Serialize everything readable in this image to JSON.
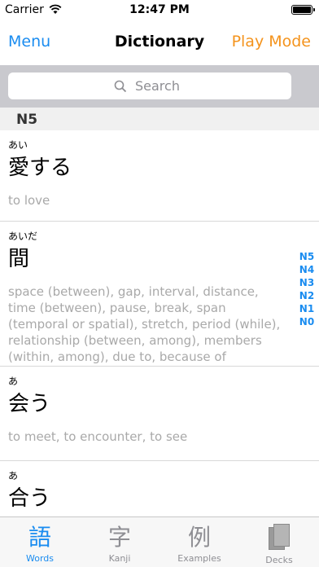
{
  "status": {
    "carrier": "Carrier",
    "time": "12:47 PM"
  },
  "nav": {
    "left": "Menu",
    "title": "Dictionary",
    "right": "Play Mode"
  },
  "search": {
    "placeholder": "Search"
  },
  "section": {
    "title": "N5"
  },
  "entries": [
    {
      "reading": "あい",
      "word": "愛する",
      "meaning": "to love"
    },
    {
      "reading": "あいだ",
      "word": "間",
      "meaning": "space (between), gap, interval, distance, time (between), pause, break, span (temporal or spatial), stretch, period (while), relationship (between, among), members (within, among), due to, because of"
    },
    {
      "reading": "あ",
      "word": "会う",
      "meaning": "to meet, to encounter, to see"
    },
    {
      "reading": "あ",
      "word": "合う",
      "meaning": ""
    }
  ],
  "index": [
    "N5",
    "N4",
    "N3",
    "N2",
    "N1",
    "N0"
  ],
  "tabs": [
    {
      "icon": "語",
      "label": "Words"
    },
    {
      "icon": "字",
      "label": "Kanji"
    },
    {
      "icon": "例",
      "label": "Examples"
    },
    {
      "icon": "deck-icon",
      "label": "Decks"
    }
  ],
  "colors": {
    "accent": "#1a8cf0",
    "play_mode": "#f4931c",
    "meaning_text": "#a9a9a9"
  }
}
